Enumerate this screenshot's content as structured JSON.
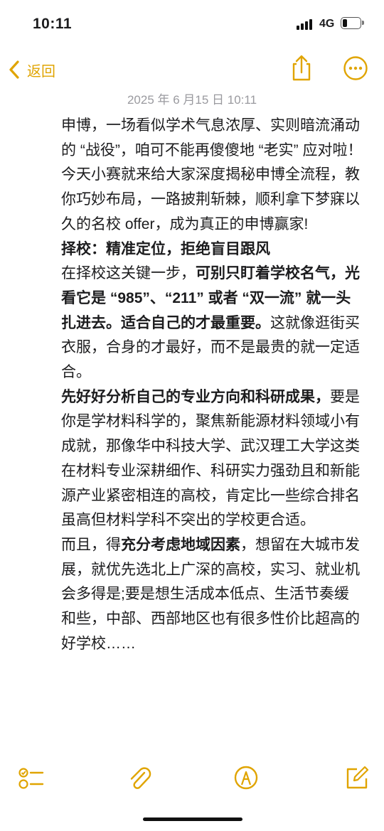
{
  "status_bar": {
    "time": "10:11",
    "network": "4G",
    "battery_level": 0.3
  },
  "nav": {
    "back_label": "返回",
    "back_icon": "chevron-left-icon",
    "share_icon": "share-icon",
    "more_icon": "ellipsis-circle-icon",
    "accent_color": "#e0a400"
  },
  "note": {
    "date": "2025 年 6 月15 日 10:11",
    "paragraphs": [
      [
        {
          "t": "申博，一场看似学术气息浓厚、实则暗流涌动的 “战役”，咱可不能再傻傻地 “老实” 应对啦！今天小赛就来给大家深度揭秘申博全流程，教"
        }
      ],
      [
        {
          "t": "你巧妙布局，一路披荆斩棘，顺利拿下梦寐以久的名校 offer，成为真正的申博赢家!"
        }
      ],
      [
        {
          "t": "择校：精准定位，拒绝盲目跟风",
          "b": true
        }
      ],
      [
        {
          "t": "在择校这关键一步，"
        },
        {
          "t": "可别只盯着学校名气，光看它是 “985”、“211” 或者 “双一流” 就一头扎进去。适合自己的才最重要。",
          "b": true
        },
        {
          "t": "这就像逛街买衣服，合身的才最好，而不是最贵的就一定适合。"
        }
      ],
      [
        {
          "t": "先好好分析自己的专业方向和科研成果，",
          "b": true
        },
        {
          "t": "要是你是学材料科学的，聚焦新能源材料领域小有成就，那像华中科技大学、武汉理工大学这类在材料专业深耕细作、科研实力强劲且和新能源产业紧密相连的高校，肯定比一些综合排名虽高但材料学科不突出的学校更合适。"
        }
      ],
      [
        {
          "t": "而且，得"
        },
        {
          "t": "充分考虑地域因素",
          "b": true
        },
        {
          "t": "，想留在大城市发展，就优先选北上广深的高校，实习、就业机会多得是;要是想生活成本低点、生活节奏缓和些，中部、西部地区也有很多性价比超高的好学校……"
        }
      ]
    ]
  },
  "toolbar": {
    "checklist_icon": "checklist-icon",
    "attachment_icon": "paperclip-icon",
    "markup_icon": "pen-markup-icon",
    "compose_icon": "compose-icon"
  }
}
